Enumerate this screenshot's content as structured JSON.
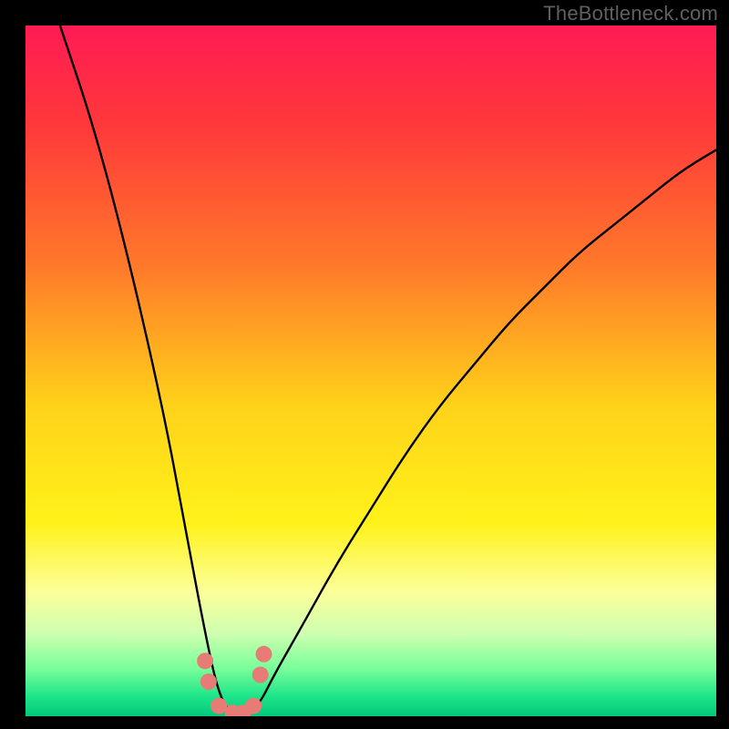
{
  "watermark": "TheBottleneck.com",
  "chart_data": {
    "type": "line",
    "title": "",
    "xlabel": "",
    "ylabel": "",
    "xlim": [
      0,
      100
    ],
    "ylim": [
      0,
      100
    ],
    "grid": false,
    "legend": null,
    "background_gradient": {
      "description": "Vertical gradient from red/pink (high bottleneck) at top through orange/yellow to green (optimal) at bottom",
      "stops": [
        {
          "pos": 0.0,
          "color": "#ff1a54"
        },
        {
          "pos": 0.15,
          "color": "#ff3a3a"
        },
        {
          "pos": 0.35,
          "color": "#ff7a2a"
        },
        {
          "pos": 0.55,
          "color": "#ffd21a"
        },
        {
          "pos": 0.72,
          "color": "#fff21a"
        },
        {
          "pos": 0.82,
          "color": "#fcff9a"
        },
        {
          "pos": 0.88,
          "color": "#cfffb0"
        },
        {
          "pos": 0.93,
          "color": "#7aff9a"
        },
        {
          "pos": 0.97,
          "color": "#20e68a"
        },
        {
          "pos": 1.0,
          "color": "#00c97a"
        }
      ]
    },
    "series": [
      {
        "name": "bottleneck-curve",
        "description": "V-shaped black curve; minimum (~0%) near x≈28–33, rising steeply to the left and more gradually to the right",
        "x": [
          5,
          10,
          15,
          20,
          23,
          26,
          28,
          30,
          32,
          34,
          36,
          40,
          45,
          50,
          55,
          60,
          65,
          70,
          75,
          80,
          85,
          90,
          95,
          100
        ],
        "values": [
          100,
          85,
          66,
          44,
          28,
          12,
          3,
          0,
          0,
          2,
          6,
          13,
          22,
          30,
          38,
          45,
          51,
          57,
          62,
          67,
          71,
          75,
          79,
          82
        ]
      },
      {
        "name": "highlight-markers",
        "description": "Salmon-colored dots clustered around the curve minimum (green band)",
        "x": [
          26.0,
          26.5,
          28.0,
          30.0,
          31.5,
          33.0,
          34.0,
          34.5
        ],
        "values": [
          8.0,
          5.0,
          1.5,
          0.5,
          0.5,
          1.5,
          6.0,
          9.0
        ]
      }
    ]
  }
}
